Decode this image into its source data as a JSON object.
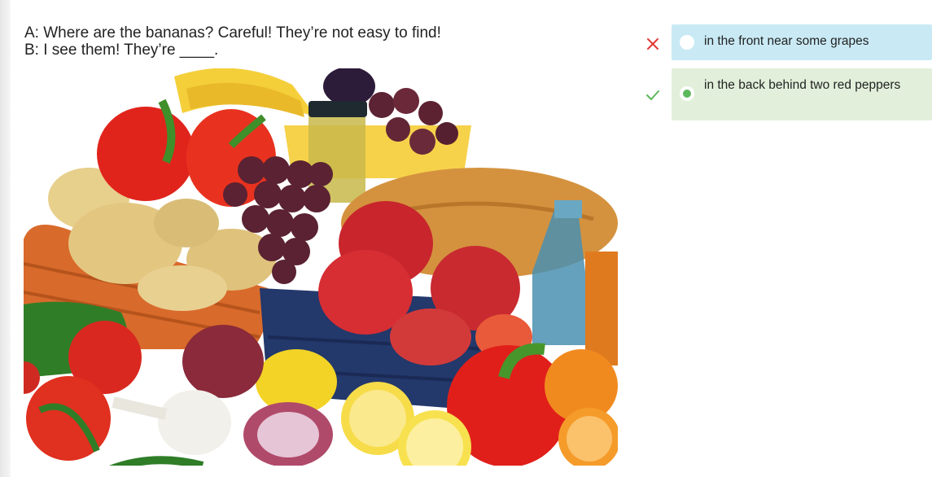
{
  "question": {
    "line_a": "A: Where are the bananas? Careful! They’re not easy to find!",
    "line_b": "B: I see them! They’re ____."
  },
  "image": {
    "subject": "pile of fruit and vegetables: peppers, potatoes, grapes, apples, bread, bananas, tomatoes, lemons, onions, oranges, garlic, jars and a bottle"
  },
  "answers": [
    {
      "text": "in the front near some grapes",
      "state": "selected",
      "mark": "x-icon",
      "mark_color": "#e53935",
      "background": "#c9eaf5"
    },
    {
      "text": "in the back behind two red peppers",
      "state": "correct",
      "mark": "check-icon",
      "mark_color": "#5cb85c",
      "background": "#e2f0db"
    }
  ]
}
